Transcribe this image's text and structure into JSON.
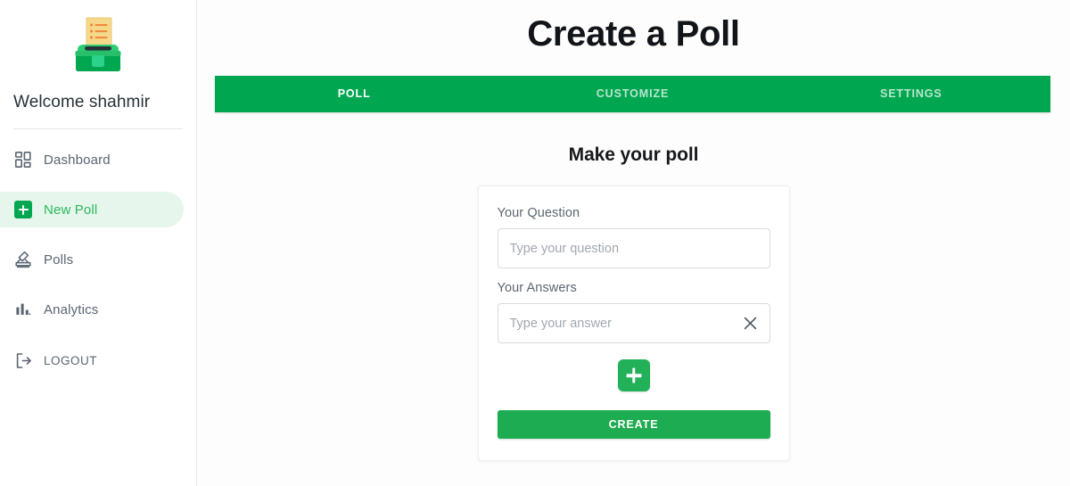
{
  "sidebar": {
    "logo_icon": "ballot-box-icon",
    "welcome": "Welcome shahmir",
    "items": [
      {
        "label": "Dashboard",
        "icon": "dashboard-grid-icon",
        "active": false
      },
      {
        "label": "New Poll",
        "icon": "plus-square-icon",
        "active": true
      },
      {
        "label": "Polls",
        "icon": "ballot-box-icon",
        "active": false
      },
      {
        "label": "Analytics",
        "icon": "bar-chart-icon",
        "active": false
      },
      {
        "label": "LOGOUT",
        "icon": "logout-arrow-icon",
        "active": false
      }
    ]
  },
  "header": {
    "title": "Create a Poll"
  },
  "tabs": [
    {
      "label": "POLL",
      "active": true
    },
    {
      "label": "CUSTOMIZE",
      "active": false
    },
    {
      "label": "SETTINGS",
      "active": false
    }
  ],
  "main": {
    "section_title": "Make your poll",
    "question": {
      "label": "Your Question",
      "placeholder": "Type your question",
      "value": ""
    },
    "answers": {
      "label": "Your Answers",
      "items": [
        {
          "placeholder": "Type your answer",
          "value": "",
          "remove_icon": "close-x-icon"
        }
      ]
    },
    "add_answer_icon": "plus-icon",
    "create_label": "CREATE"
  },
  "colors": {
    "brand_green": "#00a650",
    "create_green": "#1eac53",
    "add_green": "#22b159",
    "active_nav_bg": "#e6f6ec",
    "active_nav_text": "#2cb85d",
    "nav_text": "#5a6472",
    "title_text": "#111418"
  }
}
